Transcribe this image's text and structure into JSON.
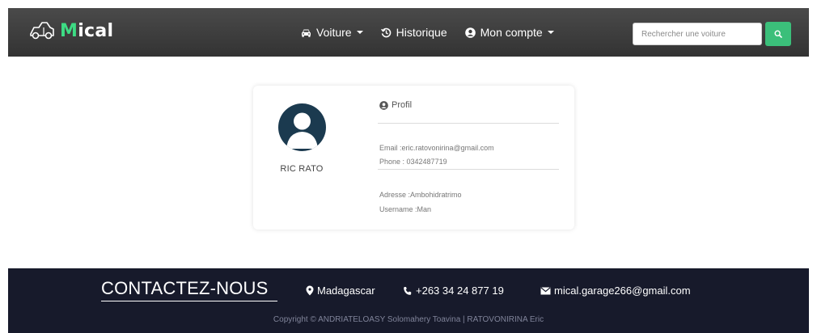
{
  "navbar": {
    "brand": {
      "first_letter": "M",
      "rest": "ical",
      "logo_icon": "car-outline-icon"
    },
    "items": [
      {
        "label": "Voiture",
        "icon": "car-icon",
        "dropdown": true
      },
      {
        "label": "Historique",
        "icon": "history-icon",
        "dropdown": false
      },
      {
        "label": "Mon compte",
        "icon": "user-circle-icon",
        "dropdown": true
      }
    ],
    "search": {
      "placeholder": "Rechercher une voiture",
      "button_icon": "search-icon"
    },
    "accent_color": "#3bbf7a"
  },
  "profile": {
    "avatar_icon": "user-avatar-icon",
    "name": "RIC RATO",
    "section_title": "Profil",
    "email": "Email :eric.ratovonirina@gmail.com",
    "phone": "Phone : 0342487719",
    "address": "Adresse :Ambohidratrimo",
    "username": "Username :Man"
  },
  "footer": {
    "title": "CONTACTEZ-NOUS",
    "location": "Madagascar",
    "phone": "+263 34 24 877 19",
    "email": "mical.garage266@gmail.com",
    "copyright": "Copyright © ANDRIATELOASY Solomahery Toavina | RATOVONIRINA Eric",
    "background_color": "#171a2b"
  }
}
